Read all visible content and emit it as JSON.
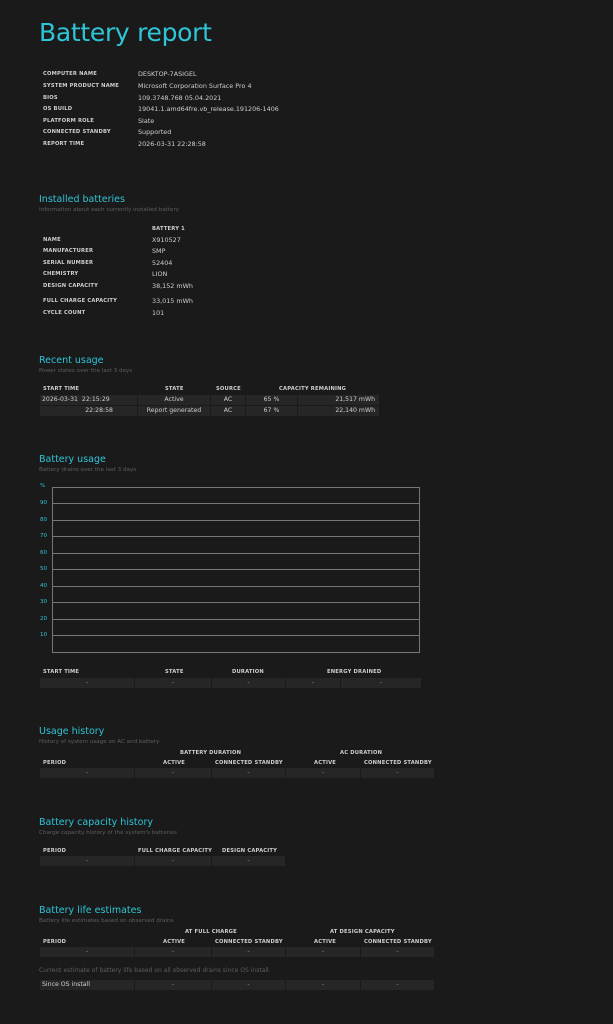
{
  "title": "Battery report",
  "system": [
    {
      "key": "COMPUTER NAME",
      "value": "DESKTOP-7ASIGEL"
    },
    {
      "key": "SYSTEM PRODUCT NAME",
      "value": "Microsoft Corporation Surface Pro 4"
    },
    {
      "key": "BIOS",
      "value": "109.3748.768 05.04.2021"
    },
    {
      "key": "OS BUILD",
      "value": "19041.1.amd64fre.vb_release.191206-1406"
    },
    {
      "key": "PLATFORM ROLE",
      "value": "Slate"
    },
    {
      "key": "CONNECTED STANDBY",
      "value": "Supported"
    },
    {
      "key": "REPORT TIME",
      "value": "2026-03-31  22:28:58"
    }
  ],
  "installed": {
    "heading": "Installed batteries",
    "subheading": "Information about each currently installed battery",
    "column": "BATTERY 1",
    "rows": [
      {
        "key": "NAME",
        "value": "X910527"
      },
      {
        "key": "MANUFACTURER",
        "value": "SMP"
      },
      {
        "key": "SERIAL NUMBER",
        "value": "52404"
      },
      {
        "key": "CHEMISTRY",
        "value": "LION"
      },
      {
        "key": "DESIGN CAPACITY",
        "value": "38,152 mWh"
      },
      {
        "key": "FULL CHARGE CAPACITY",
        "value": "33,015 mWh"
      },
      {
        "key": "CYCLE COUNT",
        "value": "101"
      }
    ]
  },
  "recent": {
    "heading": "Recent usage",
    "subheading": "Power states over the last 3 days",
    "headers": [
      "START TIME",
      "STATE",
      "SOURCE",
      "CAPACITY REMAINING"
    ],
    "rows": [
      {
        "date": "2026-03-31",
        "time": "22:15:29",
        "state": "Active",
        "source": "AC",
        "pct": "65 %",
        "mwh": "21,517 mWh"
      },
      {
        "date": "",
        "time": "22:28:58",
        "state": "Report generated",
        "source": "AC",
        "pct": "67 %",
        "mwh": "22,140 mWh"
      }
    ]
  },
  "usage": {
    "heading": "Battery usage",
    "subheading": "Battery drains over the last 3 days",
    "y_unit": "%",
    "y_ticks": [
      "90",
      "80",
      "70",
      "60",
      "50",
      "40",
      "30",
      "20",
      "10"
    ],
    "headers": [
      "START TIME",
      "STATE",
      "DURATION",
      "ENERGY DRAINED"
    ],
    "row": [
      "-",
      "-",
      "-",
      "-",
      "-"
    ]
  },
  "history": {
    "heading": "Usage history",
    "subheading": "History of system usage on AC and battery",
    "group1": "BATTERY DURATION",
    "group2": "AC DURATION",
    "headers": [
      "PERIOD",
      "ACTIVE",
      "CONNECTED STANDBY",
      "ACTIVE",
      "CONNECTED STANDBY"
    ],
    "row": [
      "-",
      "-",
      "-",
      "-",
      "-"
    ]
  },
  "capacity": {
    "heading": "Battery capacity history",
    "subheading": "Charge capacity history of the system's batteries",
    "headers": [
      "PERIOD",
      "FULL CHARGE CAPACITY",
      "DESIGN CAPACITY"
    ],
    "row": [
      "-",
      "-",
      "-"
    ]
  },
  "life": {
    "heading": "Battery life estimates",
    "subheading": "Battery life estimates based on observed drains",
    "group1": "AT FULL CHARGE",
    "group2": "AT DESIGN CAPACITY",
    "headers": [
      "PERIOD",
      "ACTIVE",
      "CONNECTED STANDBY",
      "ACTIVE",
      "CONNECTED STANDBY"
    ],
    "row": [
      "-",
      "-",
      "-",
      "-",
      "-"
    ],
    "note": "Current estimate of battery life based on all observed drains since OS install",
    "since_label": "Since OS install",
    "since_row": [
      "-",
      "-",
      "-",
      "-"
    ]
  }
}
